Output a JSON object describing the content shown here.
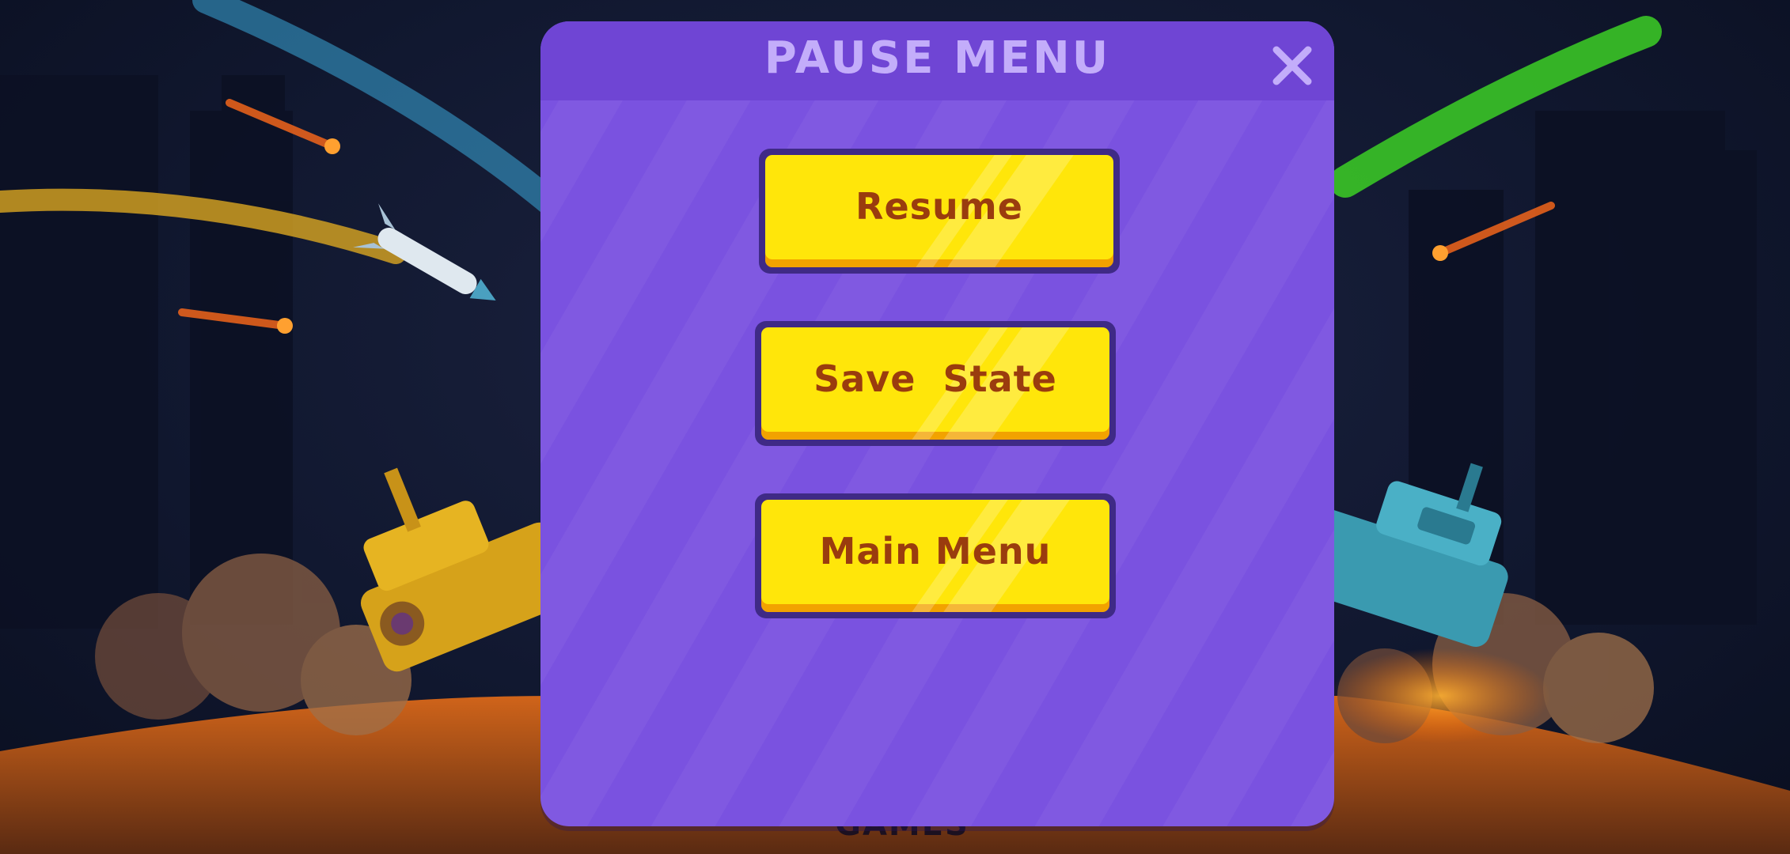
{
  "pause_menu": {
    "title": "PAUSE MENU",
    "close_icon": "close-x-icon",
    "buttons": [
      {
        "label": "Resume"
      },
      {
        "label": "Save  State"
      },
      {
        "label": "Main Menu"
      }
    ]
  },
  "background": {
    "brand_text": "GAMES",
    "left_tank": "yellow-tank",
    "right_tank": "blue-tank",
    "projectile": "missile"
  },
  "colors": {
    "dialog": "#7a52e0",
    "dialog_header": "#6f45d4",
    "title": "#c3adfa",
    "button_face": "#ffe60a",
    "button_text": "#9a3c0e",
    "button_border": "#3f2a86",
    "scene_bg": "#111830"
  }
}
